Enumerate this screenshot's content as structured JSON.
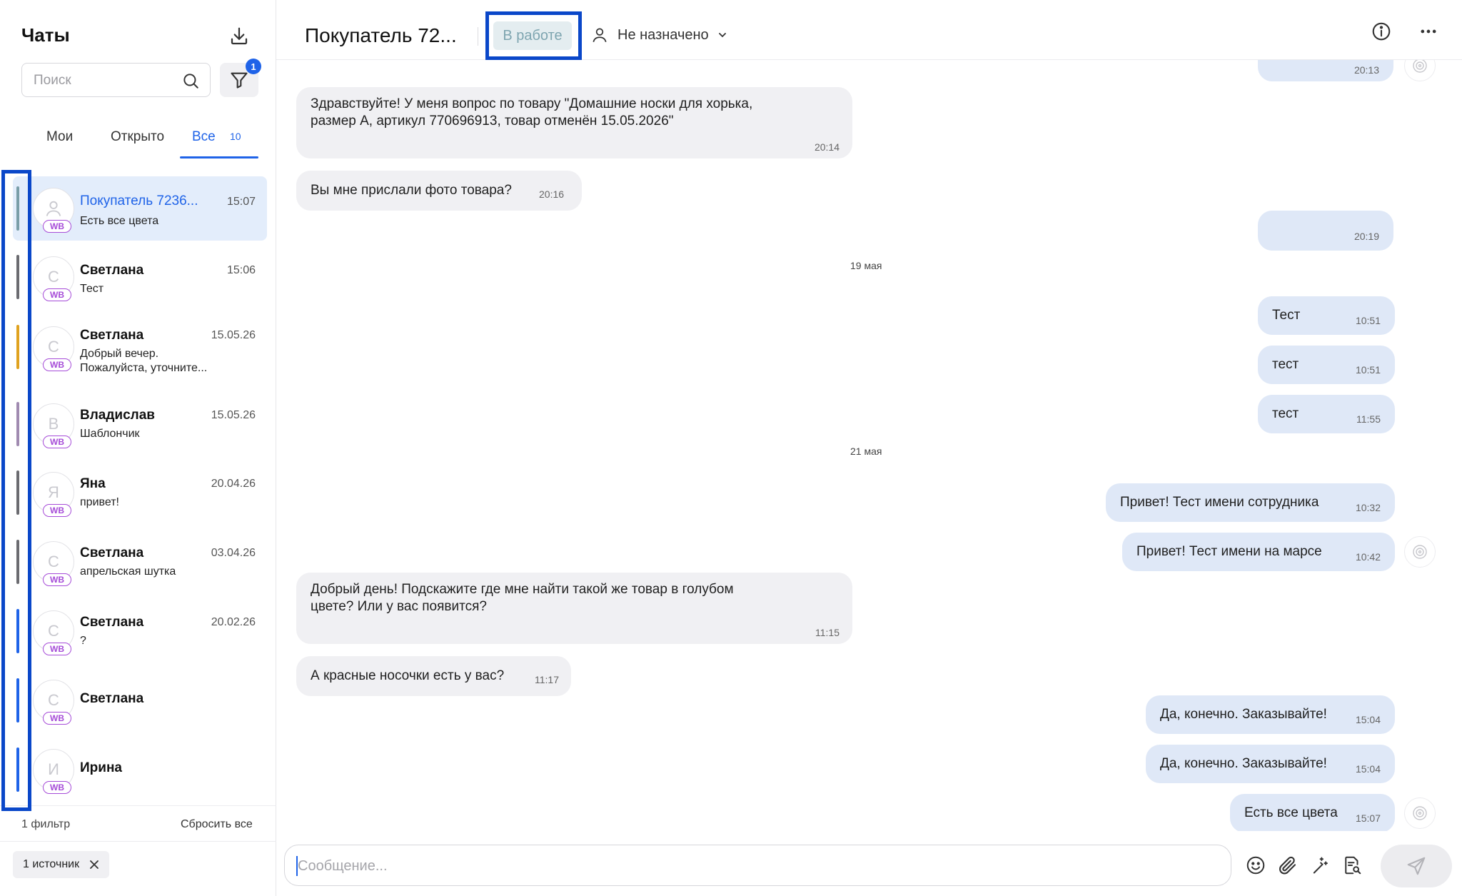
{
  "sidebar": {
    "title": "Чаты",
    "search_placeholder": "Поиск",
    "filter_badge": "1",
    "tabs": [
      {
        "label": "Мои"
      },
      {
        "label": "Открыто"
      },
      {
        "label": "Все",
        "count": "10"
      }
    ],
    "chats": [
      {
        "name": "Покупатель 7236...",
        "time": "15:07",
        "preview": "Есть все цвета",
        "avatar": "",
        "source": "WB",
        "bar_color": "#7a9ea8",
        "active": true
      },
      {
        "name": "Светлана",
        "time": "15:06",
        "preview": "Тест",
        "avatar": "С",
        "source": "WB",
        "bar_color": "#6b6b70"
      },
      {
        "name": "Светлана",
        "time": "15.05.26",
        "preview": "Добрый вечер.",
        "preview2": "Пожалуйста, уточните...",
        "avatar": "С",
        "source": "WB",
        "bar_color": "#e0a21f"
      },
      {
        "name": "Владислав",
        "time": "15.05.26",
        "preview": "Шаблончик",
        "avatar": "В",
        "source": "WB",
        "bar_color": "#a08ab0"
      },
      {
        "name": "Яна",
        "time": "20.04.26",
        "preview": "привет!",
        "avatar": "Я",
        "source": "WB",
        "bar_color": "#6b6b70"
      },
      {
        "name": "Светлана",
        "time": "03.04.26",
        "preview": "апрельская шутка",
        "avatar": "С",
        "source": "WB",
        "bar_color": "#6b6b70"
      },
      {
        "name": "Светлана",
        "time": "20.02.26",
        "preview": "?",
        "avatar": "С",
        "source": "WB",
        "bar_color": "#1f63e8"
      },
      {
        "name": "Светлана",
        "time": "",
        "preview": "",
        "avatar": "С",
        "source": "WB",
        "bar_color": "#1f63e8"
      },
      {
        "name": "Ирина",
        "time": "",
        "preview": "",
        "avatar": "И",
        "source": "WB",
        "bar_color": "#1f63e8"
      }
    ],
    "filter_count_label": "1 фильтр",
    "reset_label": "Сбросить все",
    "source_chip": "1 источник"
  },
  "header": {
    "title": "Покупатель 72...",
    "status": "В работе",
    "assignee": "Не назначено"
  },
  "messages": [
    {
      "dir": "out",
      "text": "",
      "time": "20:13"
    },
    {
      "dir": "in",
      "text": "Здравствуйте! У меня вопрос по товару \"Домашние носки для хорька,",
      "text2": "размер А, артикул 770696913, товар отменён 15.05.2026\"",
      "time": "20:14"
    },
    {
      "dir": "in",
      "text": "Вы мне прислали фото товара?",
      "time": "20:16"
    },
    {
      "dir": "out",
      "text": "",
      "time": "20:19"
    },
    {
      "day": "19 мая"
    },
    {
      "dir": "out",
      "text": "Тест",
      "time": "10:51"
    },
    {
      "dir": "out",
      "text": "тест",
      "time": "10:51"
    },
    {
      "dir": "out",
      "text": "тест",
      "time": "11:55"
    },
    {
      "day": "21 мая"
    },
    {
      "dir": "out",
      "text": "Привет! Тест имени сотрудника",
      "time": "10:32"
    },
    {
      "dir": "out",
      "text": "Привет! Тест имени на марсе",
      "time": "10:42"
    },
    {
      "dir": "in",
      "text": "Добрый день! Подскажите где мне найти такой же товар в голубом",
      "text2": "цвете? Или у вас появится?",
      "time": "11:15"
    },
    {
      "dir": "in",
      "text": "А красные носочки есть у вас?",
      "time": "11:17"
    },
    {
      "dir": "out",
      "text": "Да, конечно. Заказывайте!",
      "time": "15:04"
    },
    {
      "dir": "out",
      "text": "Да, конечно. Заказывайте!",
      "time": "15:04"
    },
    {
      "dir": "out",
      "text": "Есть все цвета",
      "time": "15:07"
    }
  ],
  "composer": {
    "placeholder": "Сообщение..."
  },
  "icons": {
    "download": "download-icon",
    "search": "search-icon",
    "filter": "filter-icon",
    "info": "info-icon",
    "more": "more-icon",
    "user": "user-icon",
    "chevron": "chevron-down-icon",
    "close": "close-icon",
    "emoji": "emoji-icon",
    "attach": "paperclip-icon",
    "magic": "magic-wand-icon",
    "template": "document-search-icon",
    "send": "send-icon",
    "read": "read-status-icon"
  },
  "colors": {
    "accent": "#1f63e8",
    "selection_frame": "#0a47c9",
    "source_badge": "#a64cd8",
    "outgoing_bubble": "#dfe8f7",
    "incoming_bubble": "#f0f0f3"
  }
}
